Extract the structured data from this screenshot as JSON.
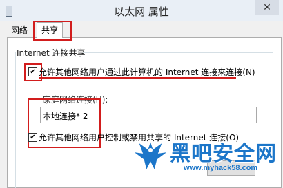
{
  "window": {
    "title": "以太网 属性",
    "close_label": "✕"
  },
  "tabs": [
    {
      "label": "网络"
    },
    {
      "label": "共享",
      "selected": true
    }
  ],
  "sharing": {
    "group_title": "Internet 连接共享",
    "allow_sharing_label": "允许其他网络用户通过此计算机的 Internet 连接来连接(N)",
    "allow_sharing_checked": true,
    "home_network_label": "家庭网络连接(H):",
    "home_network_value": "本地连接* 2",
    "allow_control_label": "允许其他网络用户控制或禁用共享的 Internet 连接(O)",
    "allow_control_checked": true
  },
  "watermark": {
    "brand": "黑吧安全网",
    "url": "www.myhack58.com"
  },
  "colors": {
    "highlight": "#d21d1d",
    "watermark": "#1c76c9"
  }
}
